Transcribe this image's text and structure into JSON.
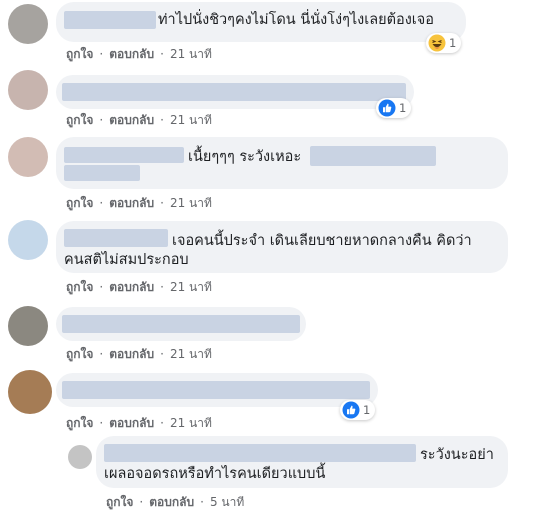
{
  "comments": [
    {
      "text": "ท่าไปนั่งชิวๆคงไม่โดน นี่นั่งโง่ๆไงเลยต้องเจอ",
      "like_label": "ถูกใจ",
      "reply_label": "ตอบกลับ",
      "time": "21 นาที",
      "reaction": {
        "type": "haha",
        "icon": "haha-emoji-icon",
        "count": "1"
      }
    },
    {
      "text": "",
      "like_label": "ถูกใจ",
      "reply_label": "ตอบกลับ",
      "time": "21 นาที",
      "reaction": {
        "type": "like",
        "icon": "like-thumb-icon",
        "count": "1"
      }
    },
    {
      "text": "เนื้ยๆๆๆ ระวังเหอะ",
      "like_label": "ถูกใจ",
      "reply_label": "ตอบกลับ",
      "time": "21 นาที"
    },
    {
      "text_line1": "เจอคนนี้ประจำ เดินเลียบชายหาดกลางคืน คิดว่า",
      "text_line2": "คนสติไม่สมประกอบ",
      "like_label": "ถูกใจ",
      "reply_label": "ตอบกลับ",
      "time": "21 นาที"
    },
    {
      "text": "",
      "like_label": "ถูกใจ",
      "reply_label": "ตอบกลับ",
      "time": "21 นาที"
    },
    {
      "text": "",
      "like_label": "ถูกใจ",
      "reply_label": "ตอบกลับ",
      "time": "21 นาที",
      "reaction": {
        "type": "like",
        "icon": "like-thumb-icon",
        "count": "1"
      }
    }
  ],
  "reply": {
    "text_line1": "ระวังนะอย่า",
    "text_line2": "เผลอจอดรถหรือทำไรคนเดียวแบบนี้",
    "like_label": "ถูกใจ",
    "reply_label": "ตอบกลับ",
    "time": "5 นาที"
  },
  "separator": "·",
  "colors": {
    "bubble": "#f0f2f5",
    "redacted": "#c9d3e3",
    "like_blue": "#1877f2",
    "meta": "#65676b"
  }
}
